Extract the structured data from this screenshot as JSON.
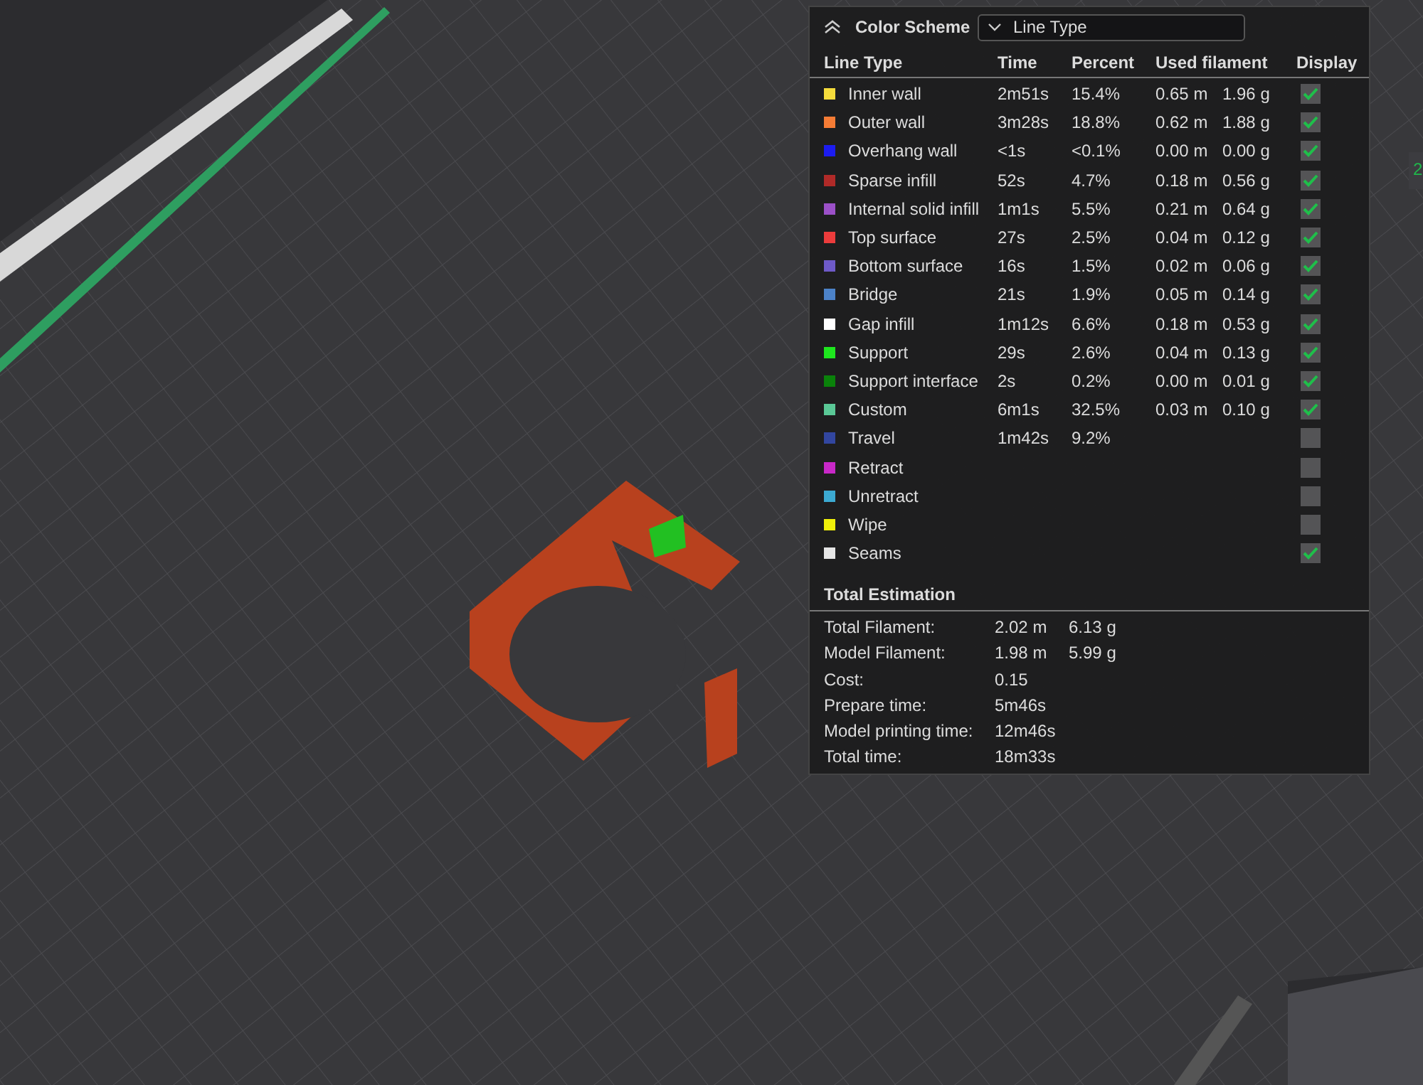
{
  "layer_label": "2",
  "legend": {
    "title": "Color Scheme",
    "scheme_dropdown": {
      "value": "Line Type"
    },
    "columns": [
      "Line Type",
      "Time",
      "Percent",
      "Used filament",
      "Display"
    ],
    "rows": [
      {
        "name": "Inner wall",
        "color": "#f5dc3c",
        "time": "2m51s",
        "percent": "15.4%",
        "length": "0.65 m",
        "weight": "1.96 g",
        "checked": true
      },
      {
        "name": "Outer wall",
        "color": "#f57c35",
        "time": "3m28s",
        "percent": "18.8%",
        "length": "0.62 m",
        "weight": "1.88 g",
        "checked": true
      },
      {
        "name": "Overhang wall",
        "color": "#1c1cf0",
        "time": "<1s",
        "percent": "<0.1%",
        "length": "0.00 m",
        "weight": "0.00 g",
        "checked": true
      },
      {
        "name": "Sparse infill",
        "color": "#b02a28",
        "time": "52s",
        "percent": "4.7%",
        "length": "0.18 m",
        "weight": "0.56 g",
        "checked": true
      },
      {
        "name": "Internal solid infill",
        "color": "#9b50c8",
        "time": "1m1s",
        "percent": "5.5%",
        "length": "0.21 m",
        "weight": "0.64 g",
        "checked": true
      },
      {
        "name": "Top surface",
        "color": "#ec3c3c",
        "time": "27s",
        "percent": "2.5%",
        "length": "0.04 m",
        "weight": "0.12 g",
        "checked": true
      },
      {
        "name": "Bottom surface",
        "color": "#6e5ac8",
        "time": "16s",
        "percent": "1.5%",
        "length": "0.02 m",
        "weight": "0.06 g",
        "checked": true
      },
      {
        "name": "Bridge",
        "color": "#4c82c8",
        "time": "21s",
        "percent": "1.9%",
        "length": "0.05 m",
        "weight": "0.14 g",
        "checked": true
      },
      {
        "name": "Gap infill",
        "color": "#ffffff",
        "time": "1m12s",
        "percent": "6.6%",
        "length": "0.18 m",
        "weight": "0.53 g",
        "checked": true
      },
      {
        "name": "Support",
        "color": "#1ee61e",
        "time": "29s",
        "percent": "2.6%",
        "length": "0.04 m",
        "weight": "0.13 g",
        "checked": true
      },
      {
        "name": "Support interface",
        "color": "#0a820a",
        "time": "2s",
        "percent": "0.2%",
        "length": "0.00 m",
        "weight": "0.01 g",
        "checked": true
      },
      {
        "name": "Custom",
        "color": "#5ac896",
        "time": "6m1s",
        "percent": "32.5%",
        "length": "0.03 m",
        "weight": "0.10 g",
        "checked": true
      },
      {
        "name": "Travel",
        "color": "#3246a0",
        "time": "1m42s",
        "percent": "9.2%",
        "checked": false
      },
      {
        "name": "Retract",
        "color": "#c828c8",
        "checked": false
      },
      {
        "name": "Unretract",
        "color": "#3caad2",
        "checked": false
      },
      {
        "name": "Wipe",
        "color": "#f0f00a",
        "checked": false
      },
      {
        "name": "Seams",
        "color": "#e6e6e6",
        "checked": true
      }
    ]
  },
  "total_estimation": {
    "title": "Total Estimation",
    "rows": [
      {
        "label": "Total Filament:",
        "value": "2.02 m",
        "value_2": "6.13 g"
      },
      {
        "label": "Model Filament:",
        "value": "1.98 m",
        "value_2": "5.99 g"
      },
      {
        "label": "Cost:",
        "value": "0.15"
      },
      {
        "label": "Prepare time:",
        "value": "5m46s"
      },
      {
        "label": "Model printing time:",
        "value": "12m46s"
      },
      {
        "label": "Total time:",
        "value": "18m33s"
      }
    ]
  }
}
